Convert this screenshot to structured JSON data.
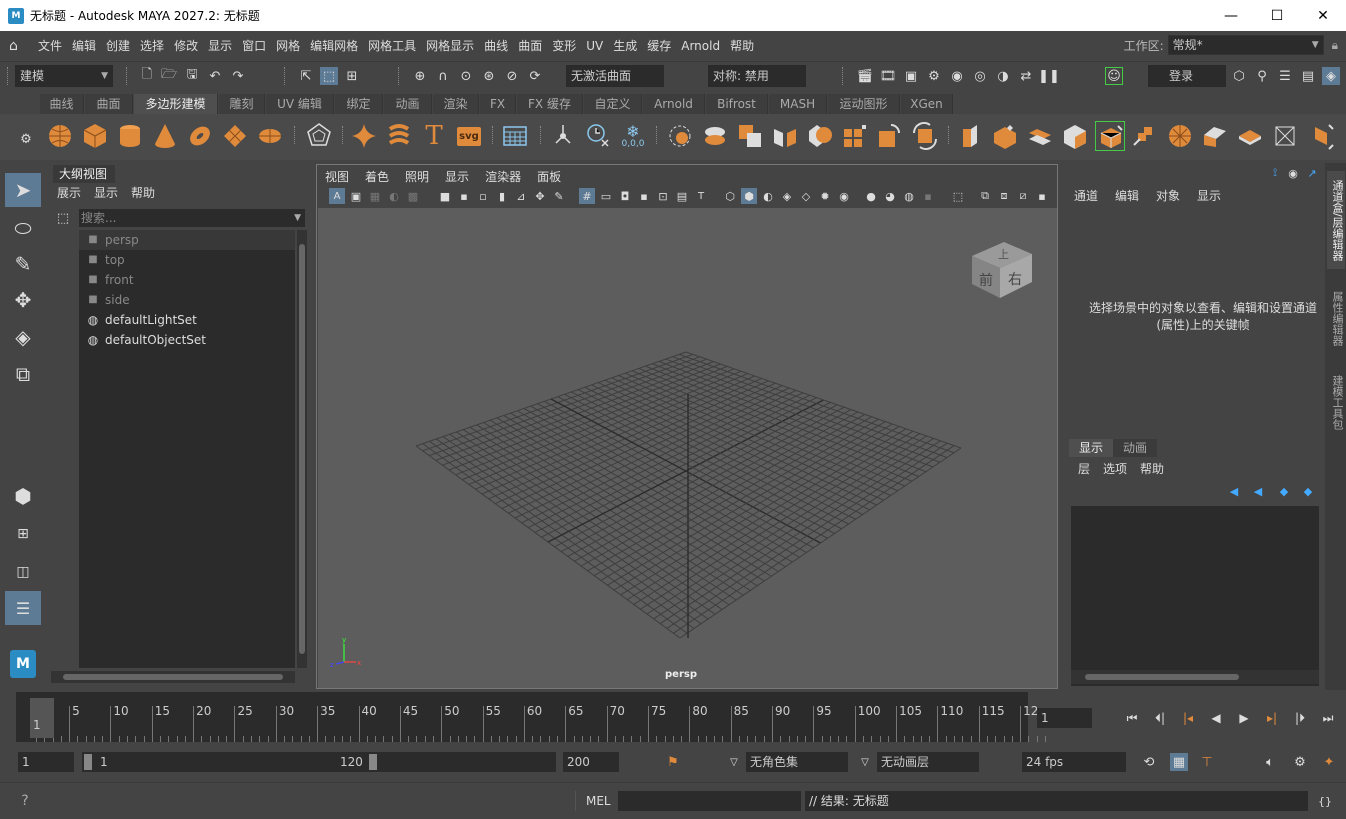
{
  "window": {
    "title": "无标题 - Autodesk MAYA 2027.2: 无标题",
    "app_icon_letter": "M",
    "minimize": "—",
    "maximize": "☐",
    "close": "✕"
  },
  "menubar": {
    "items": [
      "文件",
      "编辑",
      "创建",
      "选择",
      "修改",
      "显示",
      "窗口",
      "网格",
      "编辑网格",
      "网格工具",
      "网格显示",
      "曲线",
      "曲面",
      "变形",
      "UV",
      "生成",
      "缓存",
      "Arnold",
      "帮助"
    ],
    "workspace_label": "工作区:",
    "workspace_value": "常规*"
  },
  "statusline": {
    "mode_value": "建模",
    "no_live_surface": "无激活曲面",
    "symmetry": "对称: 禁用",
    "login": "登录"
  },
  "shelf": {
    "tabs": [
      "曲线",
      "曲面",
      "多边形建模",
      "雕刻",
      "UV 编辑",
      "绑定",
      "动画",
      "渲染",
      "FX",
      "FX 缓存",
      "自定义",
      "Arnold",
      "Bifrost",
      "MASH",
      "运动图形",
      "XGen"
    ],
    "active_tab": "多边形建模",
    "text_icon": "T",
    "svg_icon": "svg",
    "coord_icon": "0,0,0"
  },
  "outliner": {
    "title": "大纲视图",
    "menu": [
      "展示",
      "显示",
      "帮助"
    ],
    "search_placeholder": "搜索...",
    "items": [
      {
        "label": "persp",
        "type": "camera",
        "dim": true
      },
      {
        "label": "top",
        "type": "camera",
        "dim": true
      },
      {
        "label": "front",
        "type": "camera",
        "dim": true
      },
      {
        "label": "side",
        "type": "camera",
        "dim": true
      },
      {
        "label": "defaultLightSet",
        "type": "set",
        "dim": false
      },
      {
        "label": "defaultObjectSet",
        "type": "set",
        "dim": false
      }
    ]
  },
  "viewport": {
    "menu": [
      "视图",
      "着色",
      "照明",
      "显示",
      "渲染器",
      "面板"
    ],
    "camera_label": "persp",
    "viewcube": {
      "top": "上",
      "front": "前",
      "right": "右"
    },
    "axis": {
      "x": "x",
      "y": "y",
      "z": "z"
    }
  },
  "channelbox": {
    "menu": [
      "通道",
      "编辑",
      "对象",
      "显示"
    ],
    "message": "选择场景中的对象以查看、编辑和设置通道(属性)上的关键帧"
  },
  "layers": {
    "tabs": [
      "显示",
      "动画"
    ],
    "active_tab": "显示",
    "menu": [
      "层",
      "选项",
      "帮助"
    ]
  },
  "sidetabs": [
    "通道盒/层编辑器",
    "属性编辑器",
    "建模工具包"
  ],
  "timeline": {
    "start_label": "1",
    "labels": [
      "5",
      "10",
      "15",
      "20",
      "25",
      "30",
      "35",
      "40",
      "45",
      "50",
      "55",
      "60",
      "65",
      "70",
      "75",
      "80",
      "85",
      "90",
      "95",
      "100",
      "105",
      "110",
      "115",
      "12"
    ],
    "current_frame": "1"
  },
  "range": {
    "start": "1",
    "inner_start": "1",
    "inner_end": "120",
    "end": "200",
    "character_set": "无角色集",
    "anim_layer": "无动画层",
    "fps": "24 fps"
  },
  "cmdline": {
    "lang": "MEL",
    "result": "// 结果: 无标题"
  },
  "colors": {
    "accent_orange": "#e08a3c",
    "selected_blue": "#5e7b95",
    "panel_bg": "#444444",
    "field_bg": "#2b2b2b"
  }
}
